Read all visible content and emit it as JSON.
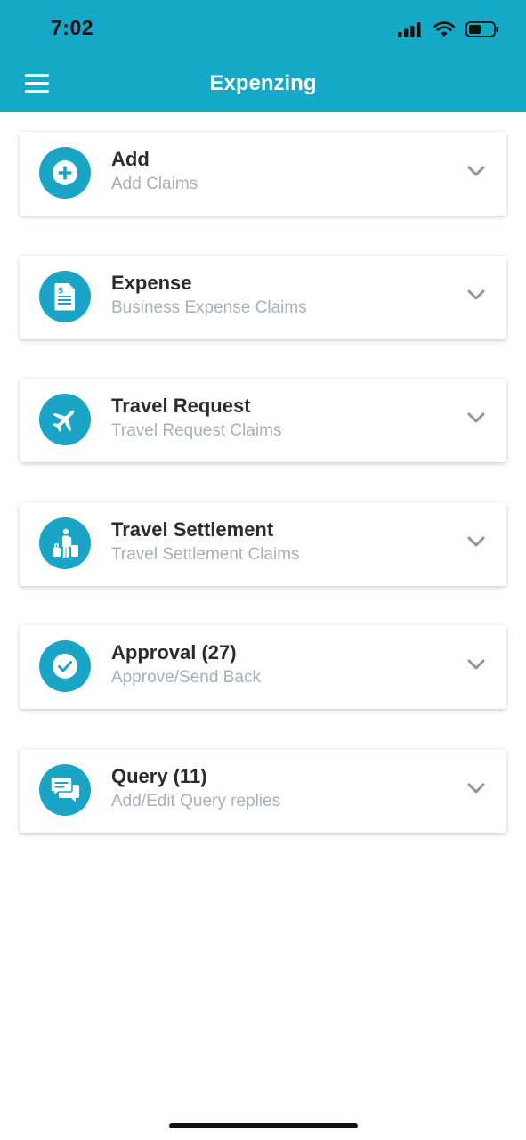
{
  "status_bar": {
    "time": "7:02",
    "icons": [
      "signal-icon",
      "wifi-icon",
      "battery-icon"
    ]
  },
  "header": {
    "title": "Expenzing",
    "menu_icon": "hamburger-menu-icon",
    "background_color": "#16a8c7"
  },
  "menu_cards": [
    {
      "title": "Add",
      "subtitle": "Add Claims",
      "icon": "add-icon"
    },
    {
      "title": "Expense",
      "subtitle": "Business Expense Claims",
      "icon": "expense-document-icon"
    },
    {
      "title": "Travel Request",
      "subtitle": "Travel Request Claims",
      "icon": "airplane-icon"
    },
    {
      "title": "Travel Settlement",
      "subtitle": "Travel Settlement Claims",
      "icon": "traveler-luggage-icon"
    },
    {
      "title": "Approval (27)",
      "subtitle": "Approve/Send Back",
      "icon": "check-icon"
    },
    {
      "title": "Query (11)",
      "subtitle": "Add/Edit Query replies",
      "icon": "chat-icon"
    }
  ],
  "colors": {
    "accent": "#1aa5c6",
    "title_text": "#2b2b2b",
    "subtitle_text": "#a7b0b8",
    "chevron": "#8a97a2"
  }
}
